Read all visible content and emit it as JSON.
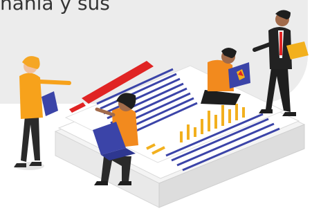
{
  "caption": {
    "text": "ñanía y sus"
  },
  "colors": {
    "banner": "#ececec",
    "accent_red": "#e02424",
    "stripe_blue": "#3b44a8",
    "bar_yellow": "#f2b01e",
    "shirt_orange": "#f28a1e",
    "suit_dark": "#222222",
    "skin": "#a26b4b"
  },
  "icons": [
    "document-stack-illustration",
    "woman-with-tablet-illustration",
    "woman-with-laptop-illustration",
    "man-with-laptop-illustration",
    "man-in-suit-illustration"
  ]
}
